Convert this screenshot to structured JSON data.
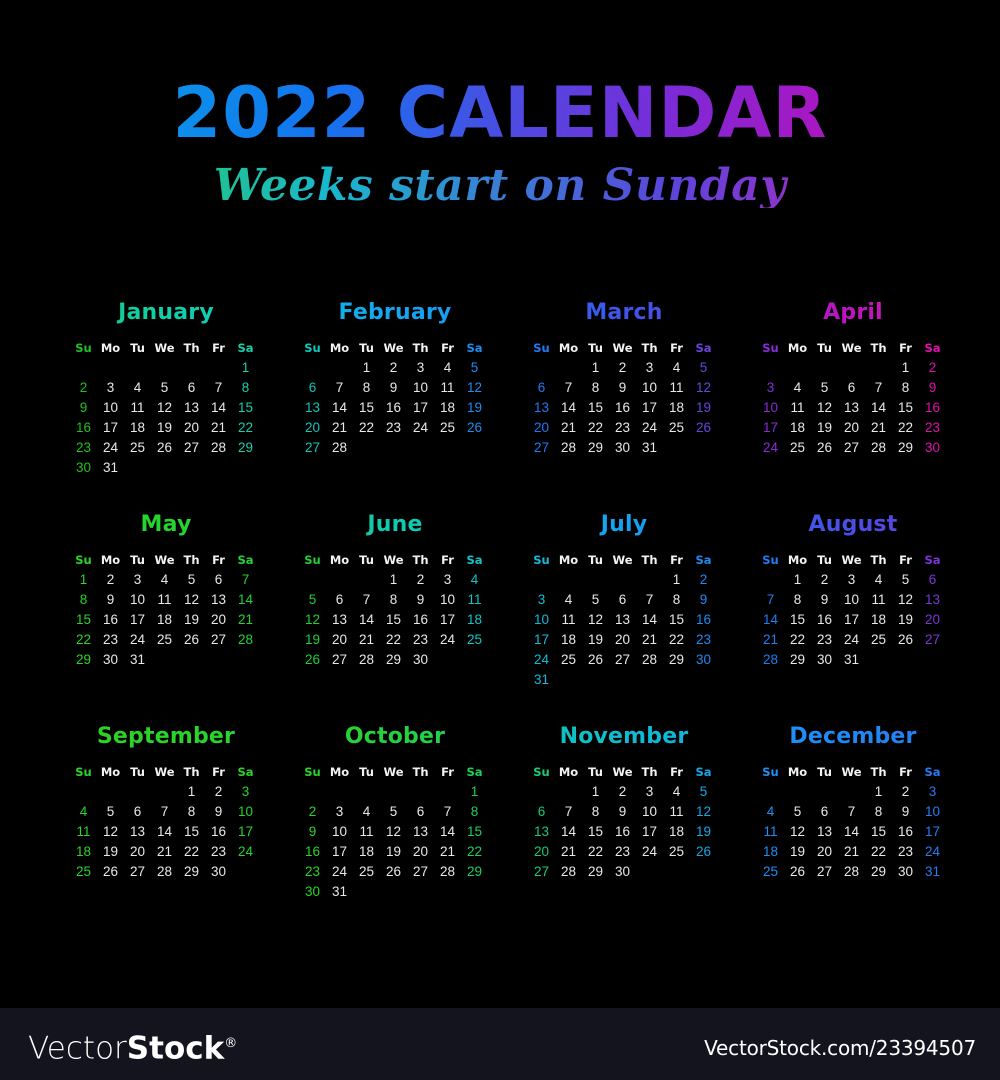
{
  "header": {
    "title": "2022 CALENDAR",
    "subtitle": "Weeks start on Sunday",
    "title_gradient": [
      "#00b4e6",
      "#1474ee",
      "#7a2bd8",
      "#e000a8"
    ],
    "subtitle_gradient": [
      "#2bd42a",
      "#19b7cd",
      "#5a46dc",
      "#e612b0"
    ]
  },
  "weekday_headers": [
    "Su",
    "Mo",
    "Tu",
    "We",
    "Th",
    "Fr",
    "Sa"
  ],
  "weekday_color": "#f2f2f2",
  "weekday_color_default": "#e8e8e8",
  "background": "#000000",
  "months": [
    {
      "name": "January",
      "name_gradient": [
        "#17c98a",
        "#10cfa9",
        "#0ad0c0"
      ],
      "sunday_color": "#1ec21e",
      "saturday_color": "#15cfae",
      "first_weekday": 6,
      "days": 31,
      "weeks": [
        [
          "",
          "",
          "",
          "",
          "",
          "",
          "1"
        ],
        [
          "2",
          "3",
          "4",
          "5",
          "6",
          "7",
          "8"
        ],
        [
          "9",
          "10",
          "11",
          "12",
          "13",
          "14",
          "15"
        ],
        [
          "16",
          "17",
          "18",
          "19",
          "20",
          "21",
          "22"
        ],
        [
          "23",
          "24",
          "25",
          "26",
          "27",
          "28",
          "29"
        ],
        [
          "30",
          "31",
          "",
          "",
          "",
          "",
          ""
        ]
      ]
    },
    {
      "name": "February",
      "name_gradient": [
        "#11b6e0",
        "#14a6ef",
        "#1b94f7"
      ],
      "sunday_color": "#13c5bb",
      "saturday_color": "#1e8df2",
      "first_weekday": 2,
      "days": 28,
      "weeks": [
        [
          "",
          "",
          "1",
          "2",
          "3",
          "4",
          "5"
        ],
        [
          "6",
          "7",
          "8",
          "9",
          "10",
          "11",
          "12"
        ],
        [
          "13",
          "14",
          "15",
          "16",
          "17",
          "18",
          "19"
        ],
        [
          "20",
          "21",
          "22",
          "23",
          "24",
          "25",
          "26"
        ],
        [
          "27",
          "28",
          "",
          "",
          "",
          "",
          ""
        ],
        [
          "",
          "",
          "",
          "",
          "",
          "",
          ""
        ]
      ]
    },
    {
      "name": "March",
      "name_gradient": [
        "#2b6bf0",
        "#3f55e8",
        "#5c44e2"
      ],
      "sunday_color": "#1f7bf4",
      "saturday_color": "#6a45dd",
      "first_weekday": 2,
      "days": 31,
      "weeks": [
        [
          "",
          "",
          "1",
          "2",
          "3",
          "4",
          "5"
        ],
        [
          "6",
          "7",
          "8",
          "9",
          "10",
          "11",
          "12"
        ],
        [
          "13",
          "14",
          "15",
          "16",
          "17",
          "18",
          "19"
        ],
        [
          "20",
          "21",
          "22",
          "23",
          "24",
          "25",
          "26"
        ],
        [
          "27",
          "28",
          "29",
          "30",
          "31",
          "",
          ""
        ],
        [
          "",
          "",
          "",
          "",
          "",
          "",
          ""
        ]
      ]
    },
    {
      "name": "April",
      "name_gradient": [
        "#a020ce",
        "#c013c2",
        "#dc0eb4"
      ],
      "sunday_color": "#8b2cd8",
      "saturday_color": "#e010ae",
      "first_weekday": 5,
      "days": 30,
      "weeks": [
        [
          "",
          "",
          "",
          "",
          "",
          "1",
          "2"
        ],
        [
          "3",
          "4",
          "5",
          "6",
          "7",
          "8",
          "9"
        ],
        [
          "10",
          "11",
          "12",
          "13",
          "14",
          "15",
          "16"
        ],
        [
          "17",
          "18",
          "19",
          "20",
          "21",
          "22",
          "23"
        ],
        [
          "24",
          "25",
          "26",
          "27",
          "28",
          "29",
          "30"
        ],
        [
          "",
          "",
          "",
          "",
          "",
          "",
          ""
        ]
      ]
    },
    {
      "name": "May",
      "name_gradient": [
        "#2ad428",
        "#25d42e",
        "#20d336"
      ],
      "sunday_color": "#2ad428",
      "saturday_color": "#22d339",
      "first_weekday": 0,
      "days": 31,
      "weeks": [
        [
          "1",
          "2",
          "3",
          "4",
          "5",
          "6",
          "7"
        ],
        [
          "8",
          "9",
          "10",
          "11",
          "12",
          "13",
          "14"
        ],
        [
          "15",
          "16",
          "17",
          "18",
          "19",
          "20",
          "21"
        ],
        [
          "22",
          "23",
          "24",
          "25",
          "26",
          "27",
          "28"
        ],
        [
          "29",
          "30",
          "31",
          "",
          "",
          "",
          ""
        ],
        [
          "",
          "",
          "",
          "",
          "",
          "",
          ""
        ]
      ]
    },
    {
      "name": "June",
      "name_gradient": [
        "#16c58f",
        "#10cbae",
        "#0ac9c6"
      ],
      "sunday_color": "#20cf35",
      "saturday_color": "#12c4c6",
      "first_weekday": 3,
      "days": 30,
      "weeks": [
        [
          "",
          "",
          "",
          "1",
          "2",
          "3",
          "4"
        ],
        [
          "5",
          "6",
          "7",
          "8",
          "9",
          "10",
          "11"
        ],
        [
          "12",
          "13",
          "14",
          "15",
          "16",
          "17",
          "18"
        ],
        [
          "19",
          "20",
          "21",
          "22",
          "23",
          "24",
          "25"
        ],
        [
          "26",
          "27",
          "28",
          "29",
          "30",
          "",
          ""
        ],
        [
          "",
          "",
          "",
          "",
          "",
          "",
          ""
        ]
      ]
    },
    {
      "name": "July",
      "name_gradient": [
        "#0fb3e8",
        "#14a2f2",
        "#1b90f8"
      ],
      "sunday_color": "#11bcd8",
      "saturday_color": "#1f8bf2",
      "first_weekday": 5,
      "days": 31,
      "weeks": [
        [
          "",
          "",
          "",
          "",
          "",
          "1",
          "2"
        ],
        [
          "3",
          "4",
          "5",
          "6",
          "7",
          "8",
          "9"
        ],
        [
          "10",
          "11",
          "12",
          "13",
          "14",
          "15",
          "16"
        ],
        [
          "17",
          "18",
          "19",
          "20",
          "21",
          "22",
          "23"
        ],
        [
          "24",
          "25",
          "26",
          "27",
          "28",
          "29",
          "30"
        ],
        [
          "31",
          "",
          "",
          "",
          "",
          "",
          ""
        ]
      ]
    },
    {
      "name": "August",
      "name_gradient": [
        "#2f63ee",
        "#4a4ee6",
        "#6b3ddc"
      ],
      "sunday_color": "#1e7ef3",
      "saturday_color": "#7b36d6",
      "first_weekday": 1,
      "days": 31,
      "weeks": [
        [
          "",
          "1",
          "2",
          "3",
          "4",
          "5",
          "6"
        ],
        [
          "7",
          "8",
          "9",
          "10",
          "11",
          "12",
          "13"
        ],
        [
          "14",
          "15",
          "16",
          "17",
          "18",
          "19",
          "20"
        ],
        [
          "21",
          "22",
          "23",
          "24",
          "25",
          "26",
          "27"
        ],
        [
          "28",
          "29",
          "30",
          "31",
          "",
          "",
          ""
        ],
        [
          "",
          "",
          "",
          "",
          "",
          "",
          ""
        ]
      ]
    },
    {
      "name": "September",
      "name_gradient": [
        "#2ed022",
        "#2ad429",
        "#26d430"
      ],
      "sunday_color": "#2ad428",
      "saturday_color": "#28d42b",
      "first_weekday": 4,
      "days": 30,
      "weeks": [
        [
          "",
          "",
          "",
          "",
          "1",
          "2",
          "3"
        ],
        [
          "4",
          "5",
          "6",
          "7",
          "8",
          "9",
          "10"
        ],
        [
          "11",
          "12",
          "13",
          "14",
          "15",
          "16",
          "17"
        ],
        [
          "18",
          "19",
          "20",
          "21",
          "22",
          "23",
          "24"
        ],
        [
          "25",
          "26",
          "27",
          "28",
          "29",
          "30",
          ""
        ],
        [
          "",
          "",
          "",
          "",
          "",
          "",
          ""
        ]
      ]
    },
    {
      "name": "October",
      "name_gradient": [
        "#2cd225",
        "#25d13f",
        "#1fcf58"
      ],
      "sunday_color": "#2ad428",
      "saturday_color": "#1dcf5c",
      "first_weekday": 6,
      "days": 31,
      "weeks": [
        [
          "",
          "",
          "",
          "",
          "",
          "",
          "1"
        ],
        [
          "2",
          "3",
          "4",
          "5",
          "6",
          "7",
          "8"
        ],
        [
          "9",
          "10",
          "11",
          "12",
          "13",
          "14",
          "15"
        ],
        [
          "16",
          "17",
          "18",
          "19",
          "20",
          "21",
          "22"
        ],
        [
          "23",
          "24",
          "25",
          "26",
          "27",
          "28",
          "29"
        ],
        [
          "30",
          "31",
          "",
          "",
          "",
          "",
          ""
        ]
      ]
    },
    {
      "name": "November",
      "name_gradient": [
        "#12c5b4",
        "#0fbcd2",
        "#11b0e2"
      ],
      "sunday_color": "#1ac97a",
      "saturday_color": "#14a8e8",
      "first_weekday": 2,
      "days": 30,
      "weeks": [
        [
          "",
          "",
          "1",
          "2",
          "3",
          "4",
          "5"
        ],
        [
          "6",
          "7",
          "8",
          "9",
          "10",
          "11",
          "12"
        ],
        [
          "13",
          "14",
          "15",
          "16",
          "17",
          "18",
          "19"
        ],
        [
          "20",
          "21",
          "22",
          "23",
          "24",
          "25",
          "26"
        ],
        [
          "27",
          "28",
          "29",
          "30",
          "",
          "",
          ""
        ],
        [
          "",
          "",
          "",
          "",
          "",
          "",
          ""
        ]
      ]
    },
    {
      "name": "December",
      "name_gradient": [
        "#1b95f6",
        "#1f89f4",
        "#2a7af0"
      ],
      "sunday_color": "#1d90f4",
      "saturday_color": "#2a7af0",
      "first_weekday": 4,
      "days": 31,
      "weeks": [
        [
          "",
          "",
          "",
          "",
          "1",
          "2",
          "3"
        ],
        [
          "4",
          "5",
          "6",
          "7",
          "8",
          "9",
          "10"
        ],
        [
          "11",
          "12",
          "13",
          "14",
          "15",
          "16",
          "17"
        ],
        [
          "18",
          "19",
          "20",
          "21",
          "22",
          "23",
          "24"
        ],
        [
          "25",
          "26",
          "27",
          "28",
          "29",
          "30",
          "31"
        ],
        [
          "",
          "",
          "",
          "",
          "",
          "",
          ""
        ]
      ]
    }
  ],
  "footer": {
    "logo_light": "Vector",
    "logo_bold": "Stock",
    "logo_registered": "®",
    "url": "VectorStock.com/23394507",
    "background": "#14141f"
  }
}
